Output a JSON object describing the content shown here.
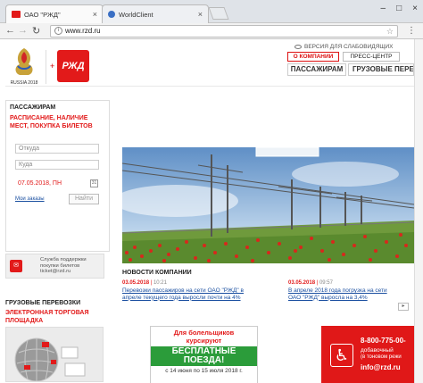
{
  "browser": {
    "tabs": [
      {
        "title": "ОАО \"РЖД\"",
        "active": true
      },
      {
        "title": "WorldClient",
        "active": false
      }
    ],
    "url": "www.rzd.ru"
  },
  "header": {
    "impaired_version": "ВЕРСИЯ ДЛЯ СЛАБОВИДЯЩИХ",
    "about": "О КОМПАНИИ",
    "press": "ПРЕСС-ЦЕНТР",
    "passengers": "ПАССАЖИРАМ",
    "cargo": "ГРУЗОВЫЕ ПЕРЕВ",
    "rzd_logo": "РЖД",
    "worldcup_logo": "RUSSIA 2018"
  },
  "left_panel": {
    "title": "ПАССАЖИРАМ",
    "subtitle": "РАСПИСАНИЕ, НАЛИЧИЕ МЕСТ, ПОКУПКА БИЛЕТОВ",
    "from_placeholder": "Откуда",
    "to_placeholder": "Куда",
    "date": "07.05.2018, ПН",
    "my_orders": "Мои заказы",
    "find": "Найти"
  },
  "support": {
    "text": "Служба поддержки покупки билетов ticket@rzd.ru"
  },
  "cargo": {
    "title": "ГРУЗОВЫЕ ПЕРЕВОЗКИ",
    "subtitle": "ЭЛЕКТРОННАЯ ТОРГОВАЯ ПЛОЩАДКА"
  },
  "news": {
    "title": "НОВОСТИ КОМПАНИИ",
    "items": [
      {
        "date": "03.05.2018",
        "time": "10:21",
        "text": "Перевозки пассажиров на сети ОАО \"РЖД\" в апреле текущего года выросли почти на 4%"
      },
      {
        "date": "03.05.2018",
        "time": "09:57",
        "text": "В апреле 2018 года погрузка на сети ОАО \"РЖД\" выросла на 3,4%"
      }
    ],
    "next": "▸"
  },
  "banners": {
    "fans_line1": "Для болельщиков",
    "fans_line2": "курсируют",
    "fans_highlight": "БЕСПЛАТНЫЕ ПОЕЗДА!",
    "fans_dates": "с 14 июня по 15 июля 2018 г.",
    "phone": "8-800-775-00-",
    "ext": "добавочный",
    "tone": "(в тоновом режи",
    "email": "info@rzd.ru"
  },
  "colors": {
    "brand_red": "#e21a1a",
    "link_blue": "#1a4fa0",
    "green": "#2b9c3a"
  }
}
